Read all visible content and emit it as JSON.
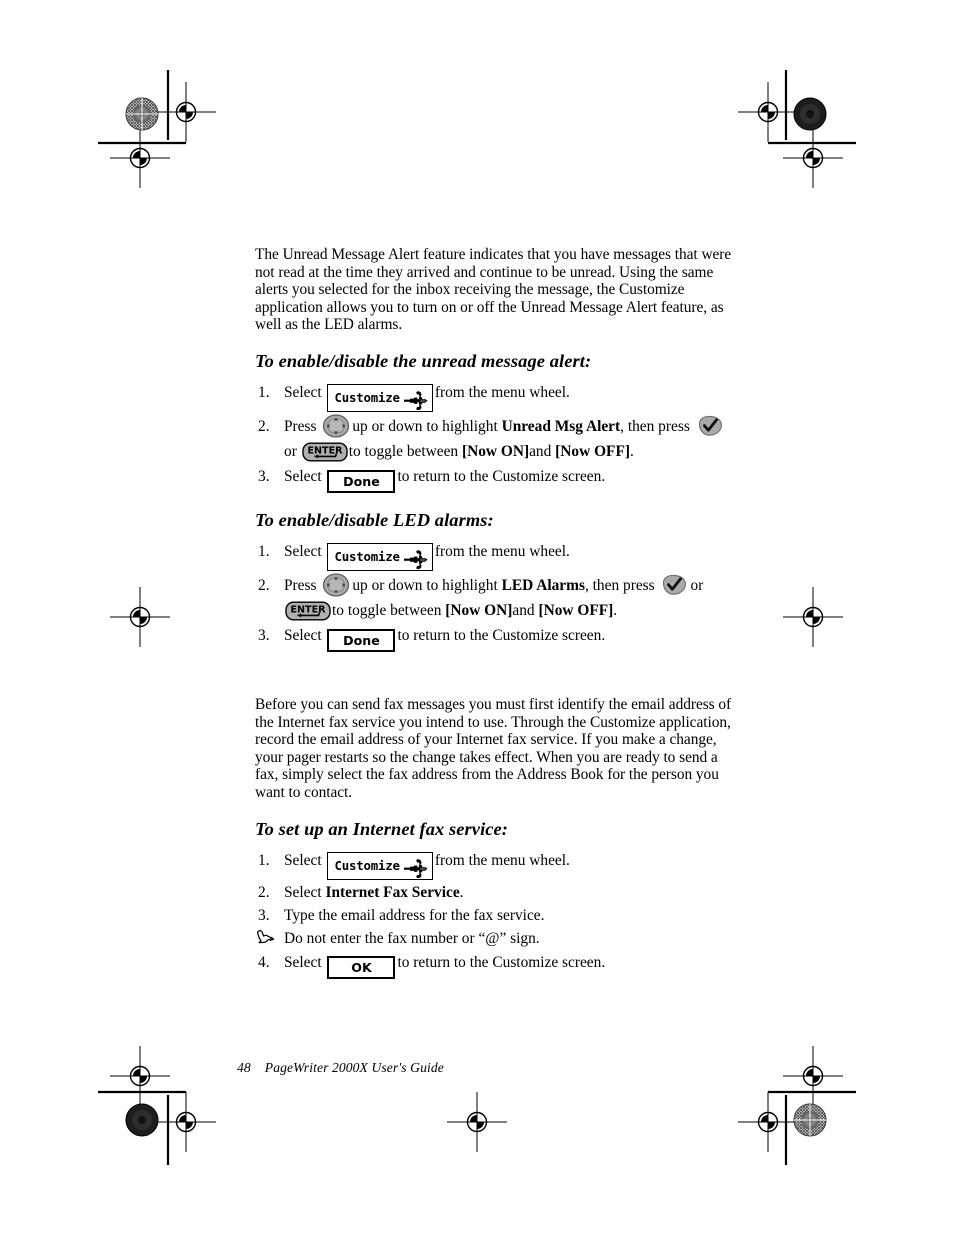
{
  "page": {
    "footer_page_number": "48",
    "footer_title": "PageWriter 2000X User's Guide"
  },
  "intro_paragraph": {
    "text": "The Unread Message Alert feature indicates that you have messages that were not read at the time they arrived and continue to be unread. Using the same alerts you selected for the inbox receiving the message, the Customize application allows you to turn on or off the Unread Message Alert feature, as well as the LED alarms."
  },
  "section_unread": {
    "heading": "To enable/disable the unread message alert:",
    "steps": [
      {
        "number": "1.",
        "prefix": "Select",
        "chip_label": "Customize",
        "chip_icon": "tools-icon",
        "suffix": "from the menu wheel."
      },
      {
        "number": "2.",
        "part1": "Press",
        "key1": "nav-wheel-icon",
        "part2": "up or down to highlight",
        "bold1": "Unread Msg Alert",
        "part3": ", then press",
        "key2": "check-key-icon",
        "part4": "or",
        "key3": "ENTER",
        "part5": "to toggle between",
        "bold2": "[Now ON]",
        "part6": "and",
        "bold3": "[Now OFF]",
        "part7": "."
      },
      {
        "number": "3.",
        "prefix": "Select",
        "button_label": "Done",
        "suffix": "to return to the Customize screen."
      }
    ]
  },
  "section_led": {
    "heading": "To enable/disable LED alarms:",
    "steps": [
      {
        "number": "1.",
        "prefix": "Select",
        "chip_label": "Customize",
        "chip_icon": "tools-icon",
        "suffix": "from the menu wheel."
      },
      {
        "number": "2.",
        "part1": "Press",
        "key1": "nav-wheel-icon",
        "part2": "up or down to highlight",
        "bold1": "LED Alarms",
        "part3": ", then press",
        "key2": "check-key-icon",
        "part4": "or",
        "key3": "ENTER",
        "part5": "to toggle between",
        "bold2": "[Now ON]",
        "part6": "and",
        "bold3": "[Now OFF]",
        "part7": "."
      },
      {
        "number": "3.",
        "prefix": "Select",
        "button_label": "Done",
        "suffix": "to return to the Customize screen."
      }
    ]
  },
  "fax_paragraph": {
    "text": "Before you can send fax messages you must first identify the email address of the Internet fax service you intend to use. Through the Customize application, record the email address of your Internet fax service. If you make a change, your pager restarts so the change takes effect. When you are ready to send a fax, simply select the fax address from the Address Book for the person you want to contact."
  },
  "section_fax": {
    "heading": "To set up an Internet fax service:",
    "steps": [
      {
        "number": "1.",
        "prefix": "Select",
        "chip_label": "Customize",
        "chip_icon": "tools-icon",
        "suffix": "from the menu wheel."
      },
      {
        "number": "2.",
        "prefix": "Select",
        "bold1": "Internet Fax Service",
        "suffix": "."
      },
      {
        "number": "3.",
        "text": "Type the email address for the fax service."
      }
    ],
    "note": {
      "icon": "pointing-hand-icon",
      "text": "Do not enter the fax number or “@” sign."
    },
    "final_step": {
      "number": "4.",
      "prefix": "Select",
      "button_label": "OK",
      "suffix": "to return to the Customize screen."
    }
  },
  "colors": {
    "text": "#000000",
    "page_background": "#ffffff",
    "key_gray": "#a9a9a9",
    "key_gray_light": "#c4c4c4",
    "crop_mark": "#000000"
  }
}
